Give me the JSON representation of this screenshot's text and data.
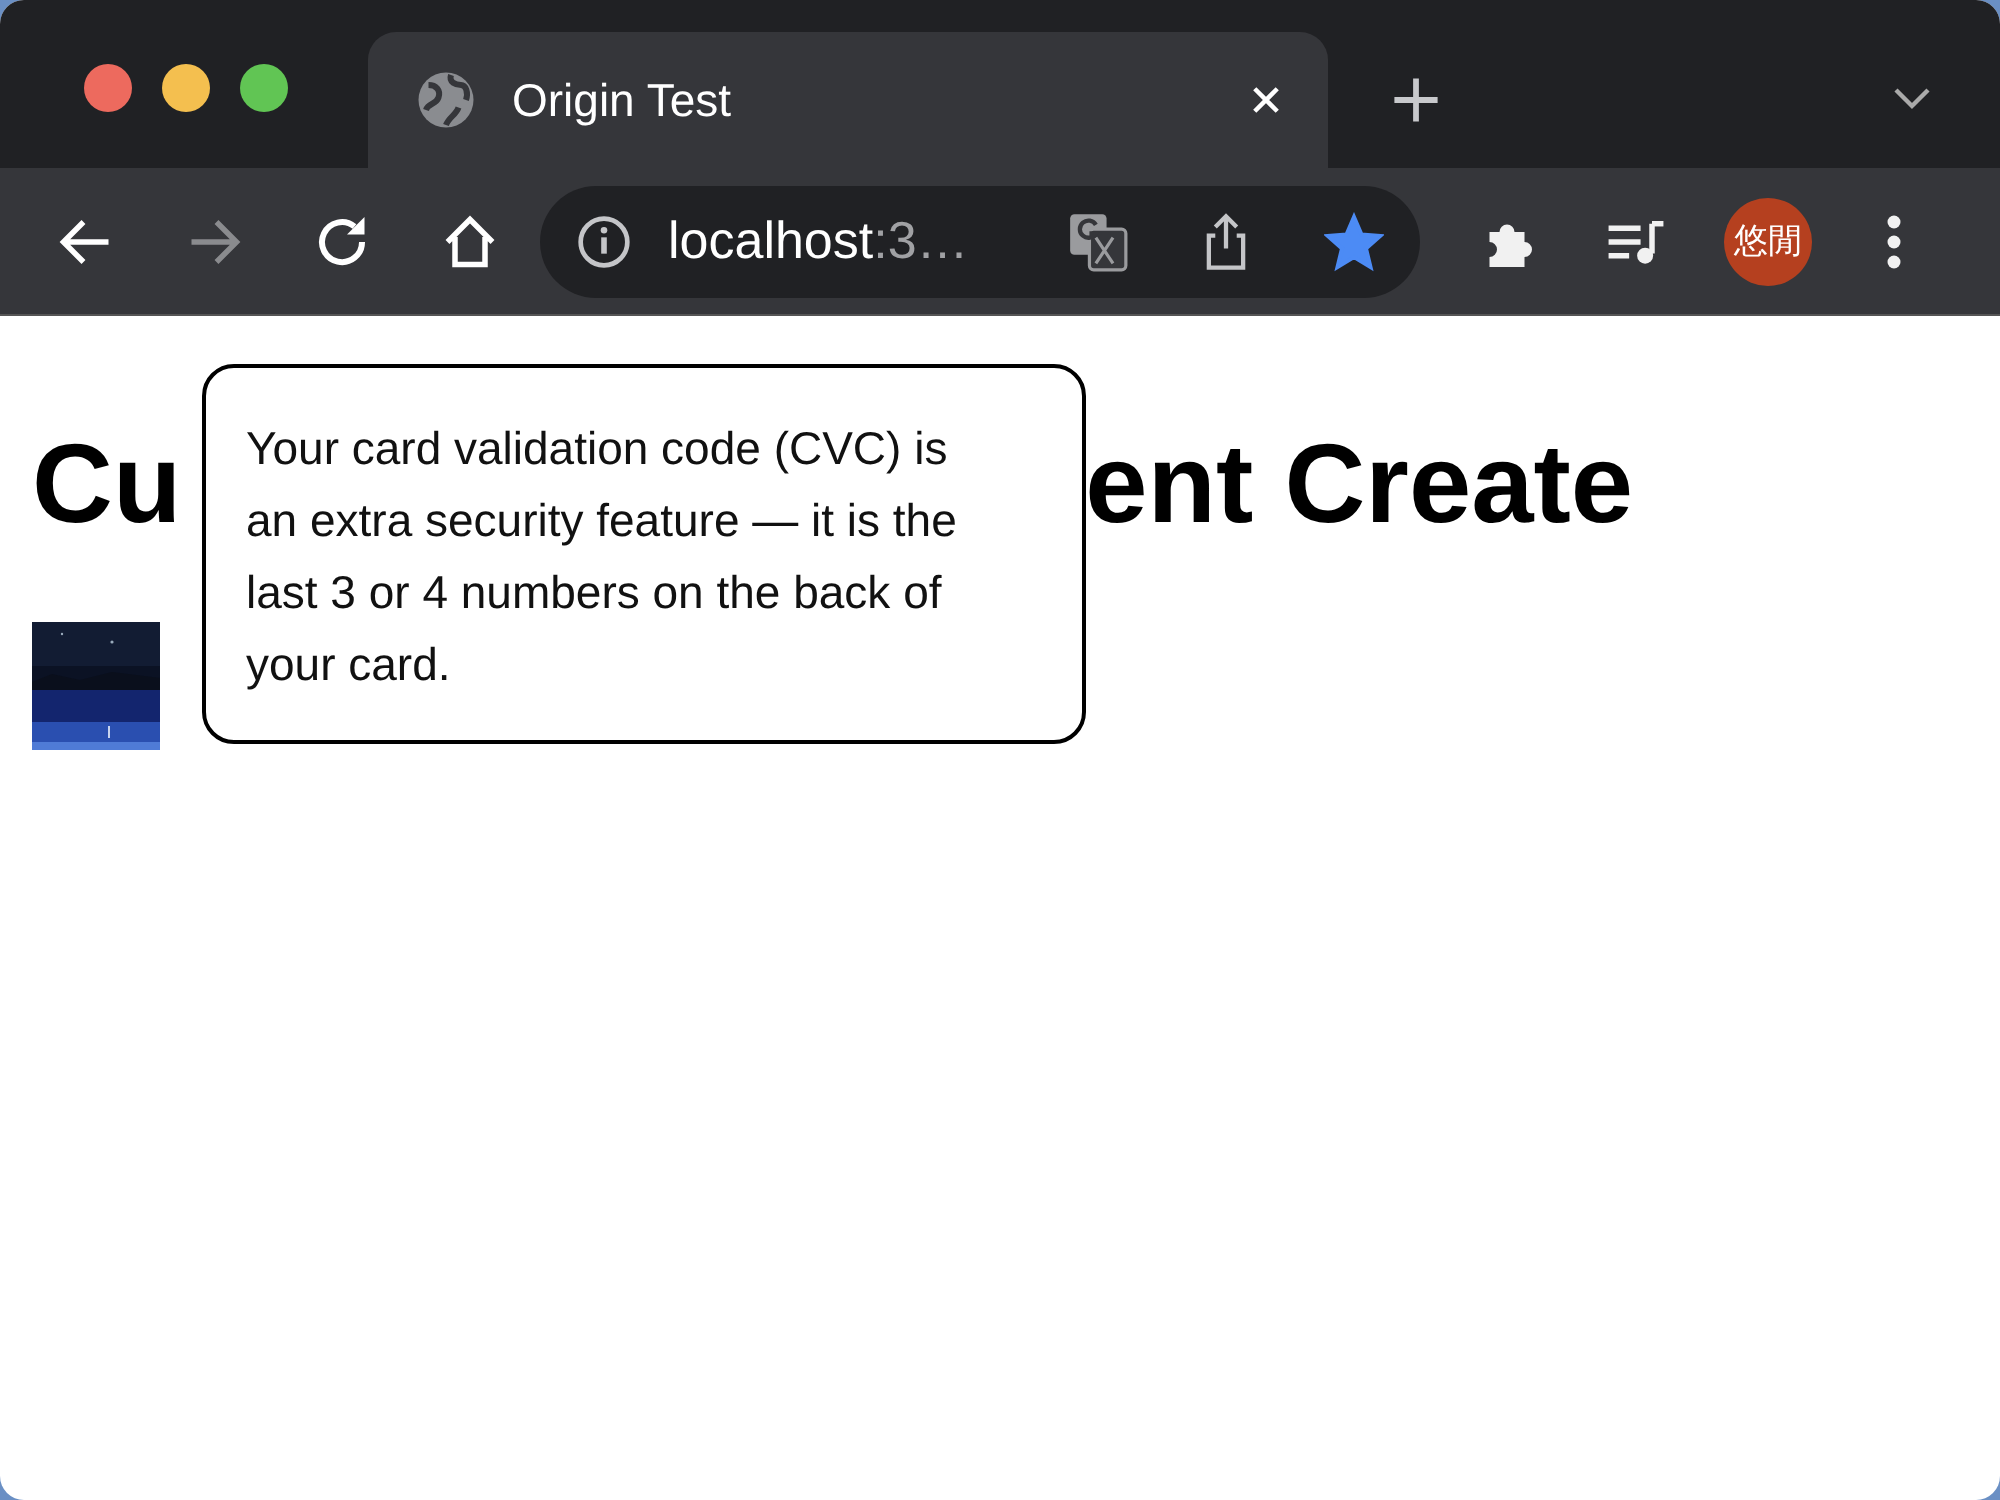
{
  "window": {
    "tabs": [
      {
        "title": "Origin Test",
        "selected": true
      }
    ]
  },
  "toolbar": {
    "nav": [
      {
        "kind": "back",
        "disabled": false
      },
      {
        "kind": "forward",
        "disabled": true
      },
      {
        "kind": "reload",
        "disabled": false
      },
      {
        "kind": "home",
        "disabled": false
      }
    ],
    "address": {
      "host": "localhost",
      "rest": ":3…"
    },
    "bookmarked": true,
    "profile": {
      "label": "悠閒",
      "color": "#b5401f"
    }
  },
  "page": {
    "heading_parts": [
      "Cu",
      "ent Create"
    ],
    "tooltip": "Your card validation code (CVC) is an extra security feature — it is the last 3 or 4 numbers on the back of your card."
  }
}
